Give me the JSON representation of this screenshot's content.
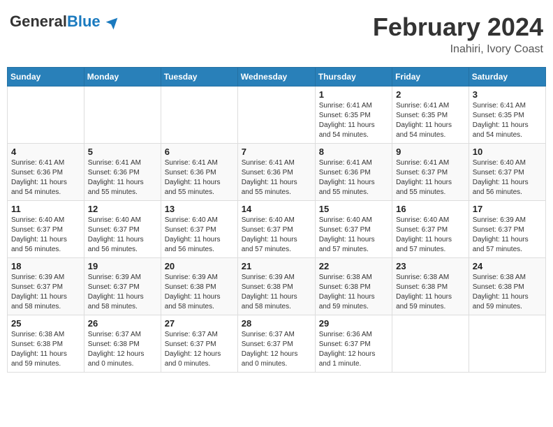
{
  "logo": {
    "general": "General",
    "blue": "Blue"
  },
  "title": {
    "month_year": "February 2024",
    "location": "Inahiri, Ivory Coast"
  },
  "weekdays": [
    "Sunday",
    "Monday",
    "Tuesday",
    "Wednesday",
    "Thursday",
    "Friday",
    "Saturday"
  ],
  "weeks": [
    [
      {
        "day": "",
        "info": ""
      },
      {
        "day": "",
        "info": ""
      },
      {
        "day": "",
        "info": ""
      },
      {
        "day": "",
        "info": ""
      },
      {
        "day": "1",
        "info": "Sunrise: 6:41 AM\nSunset: 6:35 PM\nDaylight: 11 hours\nand 54 minutes."
      },
      {
        "day": "2",
        "info": "Sunrise: 6:41 AM\nSunset: 6:35 PM\nDaylight: 11 hours\nand 54 minutes."
      },
      {
        "day": "3",
        "info": "Sunrise: 6:41 AM\nSunset: 6:35 PM\nDaylight: 11 hours\nand 54 minutes."
      }
    ],
    [
      {
        "day": "4",
        "info": "Sunrise: 6:41 AM\nSunset: 6:36 PM\nDaylight: 11 hours\nand 54 minutes."
      },
      {
        "day": "5",
        "info": "Sunrise: 6:41 AM\nSunset: 6:36 PM\nDaylight: 11 hours\nand 55 minutes."
      },
      {
        "day": "6",
        "info": "Sunrise: 6:41 AM\nSunset: 6:36 PM\nDaylight: 11 hours\nand 55 minutes."
      },
      {
        "day": "7",
        "info": "Sunrise: 6:41 AM\nSunset: 6:36 PM\nDaylight: 11 hours\nand 55 minutes."
      },
      {
        "day": "8",
        "info": "Sunrise: 6:41 AM\nSunset: 6:36 PM\nDaylight: 11 hours\nand 55 minutes."
      },
      {
        "day": "9",
        "info": "Sunrise: 6:41 AM\nSunset: 6:37 PM\nDaylight: 11 hours\nand 55 minutes."
      },
      {
        "day": "10",
        "info": "Sunrise: 6:40 AM\nSunset: 6:37 PM\nDaylight: 11 hours\nand 56 minutes."
      }
    ],
    [
      {
        "day": "11",
        "info": "Sunrise: 6:40 AM\nSunset: 6:37 PM\nDaylight: 11 hours\nand 56 minutes."
      },
      {
        "day": "12",
        "info": "Sunrise: 6:40 AM\nSunset: 6:37 PM\nDaylight: 11 hours\nand 56 minutes."
      },
      {
        "day": "13",
        "info": "Sunrise: 6:40 AM\nSunset: 6:37 PM\nDaylight: 11 hours\nand 56 minutes."
      },
      {
        "day": "14",
        "info": "Sunrise: 6:40 AM\nSunset: 6:37 PM\nDaylight: 11 hours\nand 57 minutes."
      },
      {
        "day": "15",
        "info": "Sunrise: 6:40 AM\nSunset: 6:37 PM\nDaylight: 11 hours\nand 57 minutes."
      },
      {
        "day": "16",
        "info": "Sunrise: 6:40 AM\nSunset: 6:37 PM\nDaylight: 11 hours\nand 57 minutes."
      },
      {
        "day": "17",
        "info": "Sunrise: 6:39 AM\nSunset: 6:37 PM\nDaylight: 11 hours\nand 57 minutes."
      }
    ],
    [
      {
        "day": "18",
        "info": "Sunrise: 6:39 AM\nSunset: 6:37 PM\nDaylight: 11 hours\nand 58 minutes."
      },
      {
        "day": "19",
        "info": "Sunrise: 6:39 AM\nSunset: 6:37 PM\nDaylight: 11 hours\nand 58 minutes."
      },
      {
        "day": "20",
        "info": "Sunrise: 6:39 AM\nSunset: 6:38 PM\nDaylight: 11 hours\nand 58 minutes."
      },
      {
        "day": "21",
        "info": "Sunrise: 6:39 AM\nSunset: 6:38 PM\nDaylight: 11 hours\nand 58 minutes."
      },
      {
        "day": "22",
        "info": "Sunrise: 6:38 AM\nSunset: 6:38 PM\nDaylight: 11 hours\nand 59 minutes."
      },
      {
        "day": "23",
        "info": "Sunrise: 6:38 AM\nSunset: 6:38 PM\nDaylight: 11 hours\nand 59 minutes."
      },
      {
        "day": "24",
        "info": "Sunrise: 6:38 AM\nSunset: 6:38 PM\nDaylight: 11 hours\nand 59 minutes."
      }
    ],
    [
      {
        "day": "25",
        "info": "Sunrise: 6:38 AM\nSunset: 6:38 PM\nDaylight: 11 hours\nand 59 minutes."
      },
      {
        "day": "26",
        "info": "Sunrise: 6:37 AM\nSunset: 6:38 PM\nDaylight: 12 hours\nand 0 minutes."
      },
      {
        "day": "27",
        "info": "Sunrise: 6:37 AM\nSunset: 6:37 PM\nDaylight: 12 hours\nand 0 minutes."
      },
      {
        "day": "28",
        "info": "Sunrise: 6:37 AM\nSunset: 6:37 PM\nDaylight: 12 hours\nand 0 minutes."
      },
      {
        "day": "29",
        "info": "Sunrise: 6:36 AM\nSunset: 6:37 PM\nDaylight: 12 hours\nand 1 minute."
      },
      {
        "day": "",
        "info": ""
      },
      {
        "day": "",
        "info": ""
      }
    ]
  ]
}
